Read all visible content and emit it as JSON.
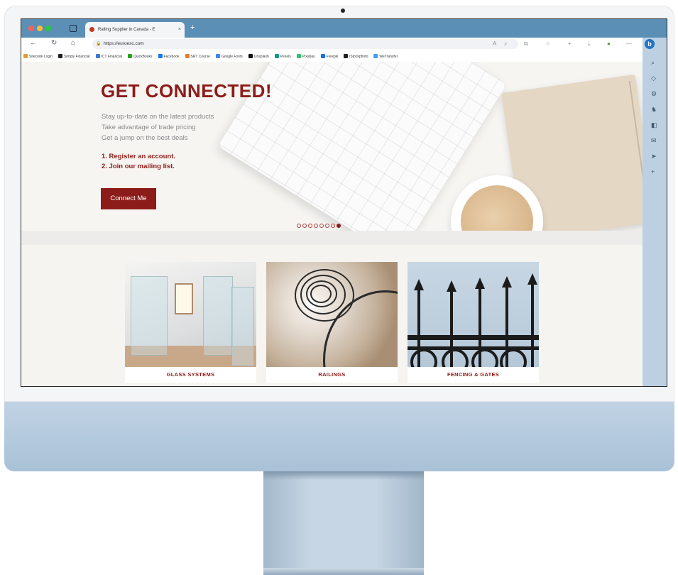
{
  "browser": {
    "tab_title": "Railing Supplier in Canada - E",
    "tab_close": "×",
    "new_tab": "+",
    "address": "https://euroesc.com",
    "bookmarks": [
      {
        "label": "Sitecode Login",
        "color": "#e0a030"
      },
      {
        "label": "Simply Financial",
        "color": "#222222"
      },
      {
        "label": "ICT Financial",
        "color": "#3d7bd6"
      },
      {
        "label": "QuickBooks",
        "color": "#2ca01c"
      },
      {
        "label": "Facebook",
        "color": "#1877f2"
      },
      {
        "label": "SRT Course",
        "color": "#e08030"
      },
      {
        "label": "Google Fonts",
        "color": "#4285f4"
      },
      {
        "label": "Unsplash",
        "color": "#111111"
      },
      {
        "label": "Pexels",
        "color": "#05a081"
      },
      {
        "label": "Pixabay",
        "color": "#2ec66d"
      },
      {
        "label": "Freepik",
        "color": "#1273eb"
      },
      {
        "label": "iStockphoto",
        "color": "#222222"
      },
      {
        "label": "WeTransfer",
        "color": "#409fff"
      }
    ]
  },
  "hero": {
    "title": "GET CONNECTED!",
    "lines": [
      "Stay up-to-date on the latest products",
      "Take advantage of trade pricing",
      "Get a jump on the best deals"
    ],
    "steps": [
      "1. Register an account.",
      "2. Join our mailing list."
    ],
    "cta_label": "Connect Me",
    "carousel_count": 8,
    "carousel_active": 8
  },
  "categories": [
    {
      "label": "GLASS SYSTEMS"
    },
    {
      "label": "RAILINGS"
    },
    {
      "label": "FENCING & GATES"
    }
  ],
  "colors": {
    "brand": "#8c1c19",
    "chrome": "#5b8fb6",
    "imac_blue": "#a9c1d7"
  }
}
